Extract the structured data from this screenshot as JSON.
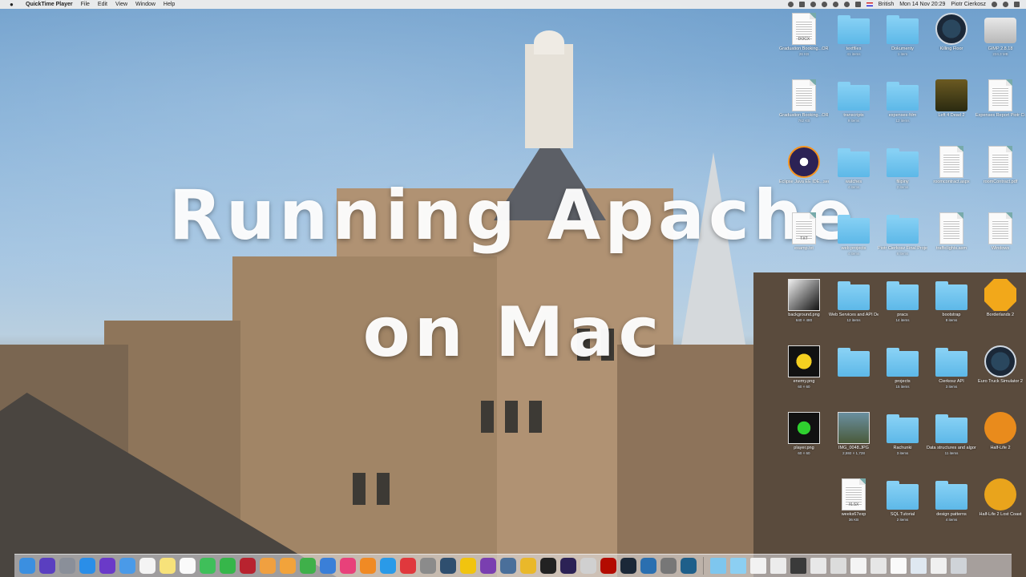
{
  "menubar": {
    "apple_icon": "apple-icon",
    "app_name": "QuickTime Player",
    "menus": [
      "File",
      "Edit",
      "View",
      "Window",
      "Help"
    ],
    "input_source": "British",
    "clock": "Mon 14 Nov  20:29",
    "user": "Piotr Cierkosz"
  },
  "overlay": {
    "line1": "Running Apache",
    "line2": "on Mac"
  },
  "desktop": {
    "icons": [
      {
        "label": "Graduation Booking...ORNING",
        "sub": "26 KB",
        "kind": "doc",
        "tag": "DOCX"
      },
      {
        "label": "textfiles",
        "sub": "41 items",
        "kind": "folder"
      },
      {
        "label": "Dokumenty",
        "sub": "1 item",
        "kind": "folder"
      },
      {
        "label": "Killing Floor",
        "sub": "",
        "kind": "steam"
      },
      {
        "label": "GIMP 2.8.18",
        "sub": "224.3 MB",
        "kind": "drive"
      },
      {
        "label": "Graduation Booking...ORNING",
        "sub": "762 KB",
        "kind": "doc",
        "tag": ""
      },
      {
        "label": "transcripts",
        "sub": "9 items",
        "kind": "folder"
      },
      {
        "label": "expenses-fdm",
        "sub": "12 items",
        "kind": "folder"
      },
      {
        "label": "Left 4 Dead 2",
        "sub": "",
        "kind": "game"
      },
      {
        "label": "Expenses Report Piotr Cierkosz",
        "sub": "",
        "kind": "doc",
        "tag": ""
      },
      {
        "label": "Eclipse Java EE IDE...sed.ink",
        "sub": "",
        "kind": "eclipse"
      },
      {
        "label": "watches",
        "sub": "4 items",
        "kind": "folder"
      },
      {
        "label": "filipiny",
        "sub": "2 items",
        "kind": "folder"
      },
      {
        "label": "roomcontract.aspx",
        "sub": "",
        "kind": "doc",
        "tag": ""
      },
      {
        "label": "roomContract.pdf",
        "sub": "",
        "kind": "doc",
        "tag": ""
      },
      {
        "label": "examp.txt",
        "sub": "",
        "kind": "doc",
        "tag": "TXT"
      },
      {
        "label": "web projects",
        "sub": "4 items",
        "kind": "folder"
      },
      {
        "label": "Piotr Cierkosz Final Project",
        "sub": "6 items",
        "kind": "folder"
      },
      {
        "label": "trafficlights.asm",
        "sub": "",
        "kind": "doc",
        "tag": ""
      },
      {
        "label": "Windows",
        "sub": "",
        "kind": "doc",
        "tag": ""
      },
      {
        "label": "background.png",
        "sub": "640 × 480",
        "kind": "thumb"
      },
      {
        "label": "Web Services and API Development",
        "sub": "12 items",
        "kind": "folder"
      },
      {
        "label": "pracs",
        "sub": "14 items",
        "kind": "folder"
      },
      {
        "label": "bootstrap",
        "sub": "8 items",
        "kind": "folder"
      },
      {
        "label": "Borderlands 2",
        "sub": "",
        "kind": "bl2"
      },
      {
        "label": "enemy.png",
        "sub": "60 × 60",
        "kind": "thumb"
      },
      {
        "label": "",
        "sub": "",
        "kind": "folder"
      },
      {
        "label": "projects",
        "sub": "15 items",
        "kind": "folder"
      },
      {
        "label": "Cierkosz API",
        "sub": "3 items",
        "kind": "folder"
      },
      {
        "label": "Euro Truck Simulator 2",
        "sub": "",
        "kind": "steam"
      },
      {
        "label": "player.png",
        "sub": "60 × 60",
        "kind": "thumb"
      },
      {
        "label": "IMG_0048.JPG",
        "sub": "2,592 × 1,728",
        "kind": "thumb"
      },
      {
        "label": "Rachunki",
        "sub": "3 items",
        "kind": "folder"
      },
      {
        "label": "Data structures and algorithms",
        "sub": "11 items",
        "kind": "folder"
      },
      {
        "label": "Half-Life 2",
        "sub": "",
        "kind": "hl"
      },
      {
        "label": "weeks67exp",
        "sub": "36 KB",
        "kind": "doc",
        "tag": "XLSX"
      },
      {
        "label": "SQL Tutorial",
        "sub": "2 items",
        "kind": "folder"
      },
      {
        "label": "design patterns",
        "sub": "4 items",
        "kind": "folder"
      },
      {
        "label": "Half-Life 2 Lost Coast",
        "sub": "",
        "kind": "hl2"
      }
    ]
  },
  "dock": {
    "apps": [
      {
        "name": "finder",
        "color": "#3b8fe0"
      },
      {
        "name": "siri",
        "color": "#5a3fc0"
      },
      {
        "name": "launchpad",
        "color": "#8a8f99"
      },
      {
        "name": "safari",
        "color": "#2a8ee8"
      },
      {
        "name": "imovie",
        "color": "#6a3ac8"
      },
      {
        "name": "mail",
        "color": "#4a9ae8"
      },
      {
        "name": "calendar",
        "color": "#f4f4f4"
      },
      {
        "name": "notes",
        "color": "#f7e27a"
      },
      {
        "name": "reminders",
        "color": "#fafafa"
      },
      {
        "name": "messages",
        "color": "#3fbf5a"
      },
      {
        "name": "facetime",
        "color": "#36b64a"
      },
      {
        "name": "photo-booth",
        "color": "#b8232f"
      },
      {
        "name": "photos",
        "color": "#f0a040"
      },
      {
        "name": "pages",
        "color": "#f2a33b"
      },
      {
        "name": "numbers",
        "color": "#3fb04a"
      },
      {
        "name": "keynote",
        "color": "#3a7fd8"
      },
      {
        "name": "itunes",
        "color": "#e8417a"
      },
      {
        "name": "ibooks",
        "color": "#f08a24"
      },
      {
        "name": "app-store",
        "color": "#2a9ae8"
      },
      {
        "name": "vivaldi",
        "color": "#e0383d"
      },
      {
        "name": "system-preferences",
        "color": "#8b8b8b"
      },
      {
        "name": "quicktime",
        "color": "#2f4f6f"
      },
      {
        "name": "sequel",
        "color": "#f1c40f"
      },
      {
        "name": "tor",
        "color": "#7a3fb0"
      },
      {
        "name": "xcode",
        "color": "#4a6f9a"
      },
      {
        "name": "chrome",
        "color": "#e9b82a"
      },
      {
        "name": "terminal",
        "color": "#222222"
      },
      {
        "name": "eclipse",
        "color": "#2c2255"
      },
      {
        "name": "help",
        "color": "#d0d0d0"
      },
      {
        "name": "acrobat",
        "color": "#b30b00"
      },
      {
        "name": "steam",
        "color": "#1b2838"
      },
      {
        "name": "world",
        "color": "#2a6fb0"
      },
      {
        "name": "brush",
        "color": "#777"
      },
      {
        "name": "packet-tracer",
        "color": "#1e5f8a"
      }
    ],
    "stacks": [
      {
        "name": "applications-stack",
        "color": "#7ec6ee"
      },
      {
        "name": "documents-stack",
        "color": "#8ccff2"
      },
      {
        "name": "file-1",
        "color": "#f2f2f2"
      },
      {
        "name": "file-2",
        "color": "#ececec"
      },
      {
        "name": "file-3",
        "color": "#3a3a3a"
      },
      {
        "name": "file-4",
        "color": "#e8e8e8"
      },
      {
        "name": "file-5",
        "color": "#dcdcdc"
      },
      {
        "name": "file-6",
        "color": "#f4f4f4"
      },
      {
        "name": "file-7",
        "color": "#e6e6e6"
      },
      {
        "name": "file-8",
        "color": "#fafafa"
      },
      {
        "name": "file-9",
        "color": "#dfe8f1"
      },
      {
        "name": "file-10",
        "color": "#f0f0f0"
      },
      {
        "name": "trash",
        "color": "#cfd3d8"
      }
    ]
  }
}
